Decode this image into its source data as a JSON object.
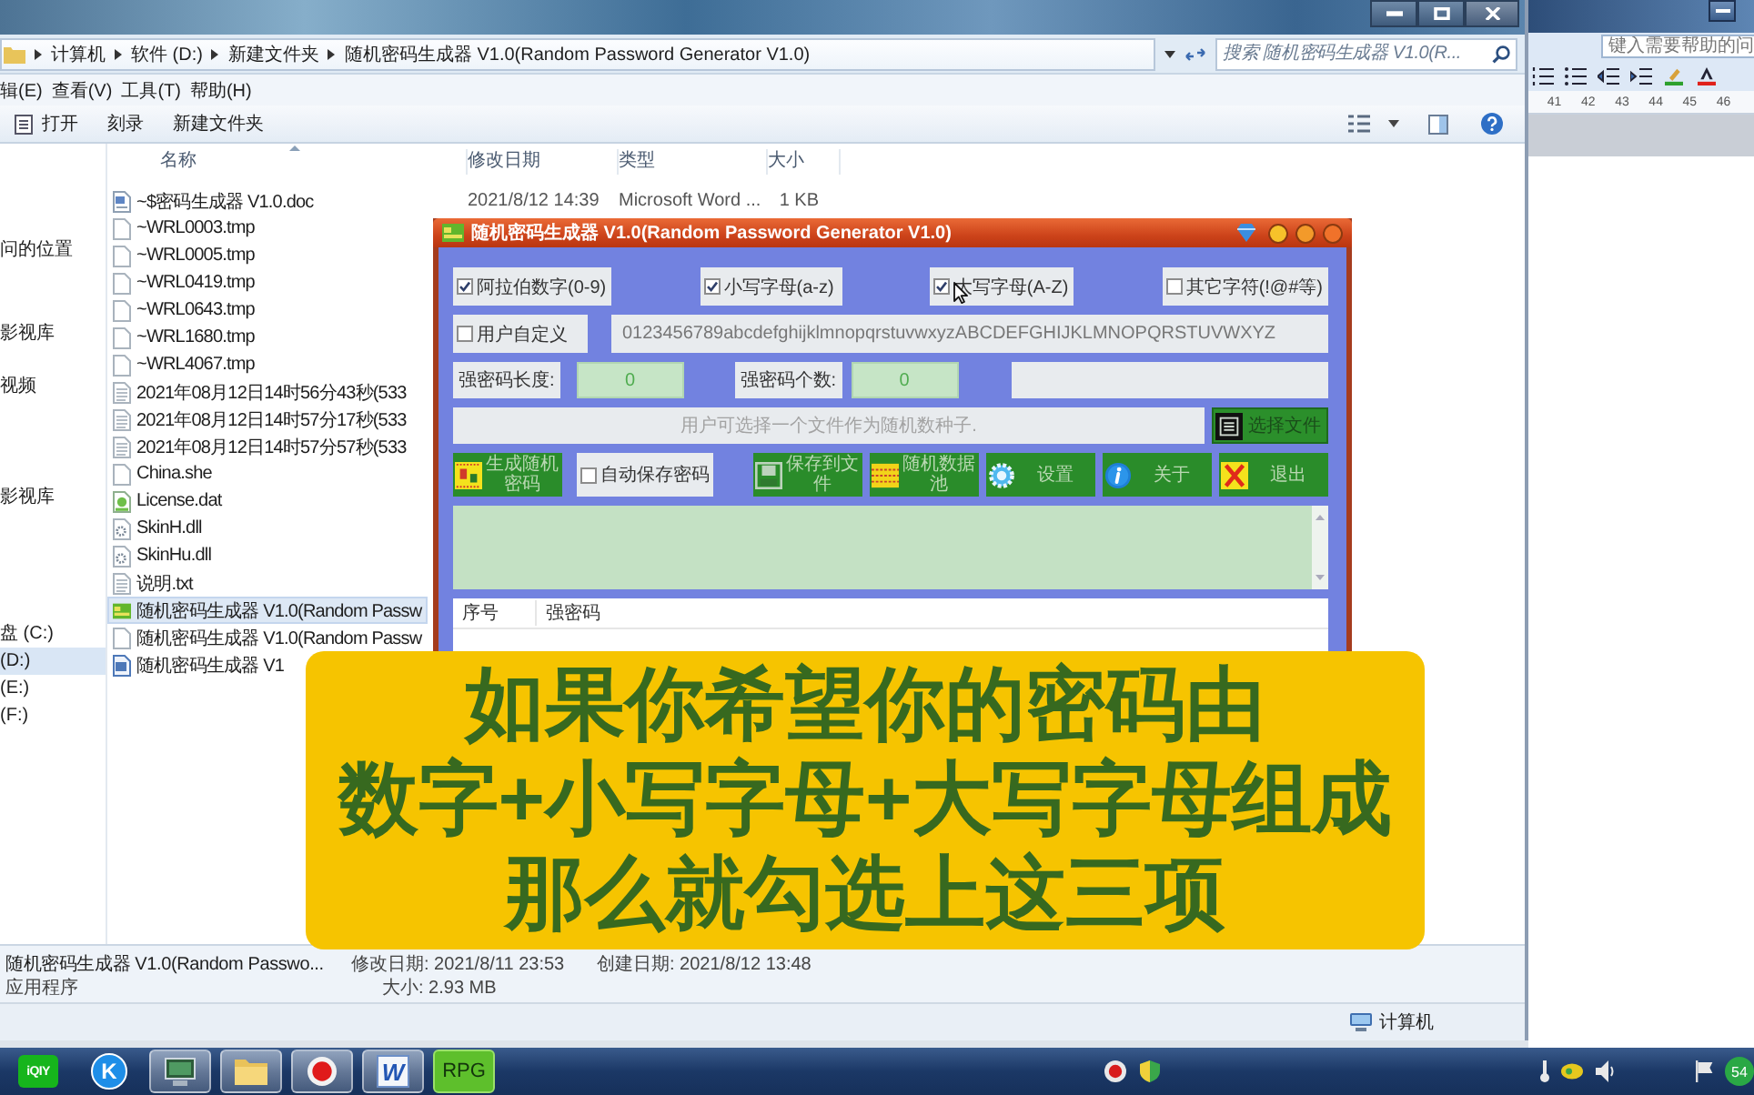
{
  "explorer": {
    "breadcrumb": [
      "计算机",
      "软件 (D:)",
      "新建文件夹",
      "随机密码生成器 V1.0(Random Password Generator V1.0)"
    ],
    "search": {
      "placeholder": "搜索 随机密码生成器 V1.0(R..."
    },
    "menu": [
      "辑(E)",
      "查看(V)",
      "工具(T)",
      "帮助(H)"
    ],
    "toolbar": [
      {
        "label": "打开",
        "kind": "open"
      },
      {
        "label": "刻录",
        "kind": "plain"
      },
      {
        "label": "新建文件夹",
        "kind": "plain"
      }
    ],
    "nav": [
      {
        "label": "问的位置",
        "selected": false
      },
      {
        "label": "影视库",
        "selected": false
      },
      {
        "label": "视频",
        "selected": false
      },
      {
        "label": "影视库",
        "selected": false
      },
      {
        "label": "盘 (C:)",
        "selected": false
      },
      {
        "label": "(D:)",
        "selected": true
      },
      {
        "label": "(E:)",
        "selected": false
      },
      {
        "label": "(F:)",
        "selected": false
      }
    ],
    "columns": [
      "名称",
      "修改日期",
      "类型",
      "大小"
    ],
    "files": [
      {
        "name": "~$密码生成器 V1.0.doc",
        "modified": "2021/8/12 14:39",
        "type": "Microsoft Word ...",
        "size": "1 KB",
        "kind": "doc",
        "selected": false
      },
      {
        "name": "~WRL0003.tmp",
        "kind": "blank",
        "selected": false
      },
      {
        "name": "~WRL0005.tmp",
        "kind": "blank",
        "selected": false
      },
      {
        "name": "~WRL0419.tmp",
        "kind": "blank",
        "selected": false
      },
      {
        "name": "~WRL0643.tmp",
        "kind": "blank",
        "selected": false
      },
      {
        "name": "~WRL1680.tmp",
        "kind": "blank",
        "selected": false
      },
      {
        "name": "~WRL4067.tmp",
        "kind": "blank",
        "selected": false
      },
      {
        "name": "2021年08月12日14时56分43秒(533",
        "kind": "text",
        "selected": false
      },
      {
        "name": "2021年08月12日14时57分17秒(533",
        "kind": "text",
        "selected": false
      },
      {
        "name": "2021年08月12日14时57分57秒(533",
        "kind": "text",
        "selected": false
      },
      {
        "name": "China.she",
        "kind": "blank",
        "selected": false
      },
      {
        "name": "License.dat",
        "kind": "license",
        "selected": false
      },
      {
        "name": "SkinH.dll",
        "kind": "dll",
        "selected": false
      },
      {
        "name": "SkinHu.dll",
        "kind": "dll",
        "selected": false
      },
      {
        "name": "说明.txt",
        "kind": "text",
        "selected": false
      },
      {
        "name": "随机密码生成器 V1.0(Random Passw",
        "kind": "app",
        "selected": true
      },
      {
        "name": "随机密码生成器 V1.0(Random Passw",
        "kind": "blank",
        "selected": false
      },
      {
        "name": "随机密码生成器 V1",
        "kind": "word",
        "selected": false
      }
    ],
    "details": {
      "name": "随机密码生成器 V1.0(Random Passwo...",
      "kind_label": "应用程序",
      "modified": "修改日期: 2021/8/11 23:53",
      "created": "创建日期: 2021/8/12 13:48",
      "size": "大小: 2.93 MB"
    },
    "status": "计算机"
  },
  "word": {
    "help": {
      "placeholder": "键入需要帮助的问"
    },
    "ruler": [
      "41",
      "42",
      "43",
      "44",
      "45",
      "46"
    ]
  },
  "rpg": {
    "title": "随机密码生成器 V1.0(Random Password Generator V1.0)",
    "charsets": [
      {
        "label": "阿拉伯数字(0-9)",
        "checked": true
      },
      {
        "label": "小写字母(a-z)",
        "checked": true
      },
      {
        "label": "大写字母(A-Z)",
        "checked": true
      },
      {
        "label": "其它字符(!@#等)",
        "checked": false
      }
    ],
    "custom": {
      "label": "用户自定义",
      "checked": false,
      "value": "0123456789abcdefghijklmnopqrstuvwxyzABCDEFGHIJKLMNOPQRSTUVWXYZ"
    },
    "length": {
      "label": "强密码长度:",
      "value": "0"
    },
    "count": {
      "label": "强密码个数:",
      "value": "0"
    },
    "seed": {
      "placeholder": "用户可选择一个文件作为随机数种子."
    },
    "seed_button": "选择文件",
    "actions": [
      {
        "label": "生成随机密码",
        "kind": "generate"
      },
      {
        "label": "自动保存密码",
        "kind": "checkbox",
        "checked": false
      },
      {
        "label": "保存到文件",
        "kind": "save"
      },
      {
        "label": "随机数据池",
        "kind": "pool"
      },
      {
        "label": "设置",
        "kind": "settings"
      },
      {
        "label": "关于",
        "kind": "about"
      },
      {
        "label": "退出",
        "kind": "exit"
      }
    ],
    "list_columns": [
      "序号",
      "强密码"
    ]
  },
  "subtitle": [
    "如果你希望你的密码由",
    "数字+小写字母+大写字母组成",
    "那么就勾选上这三项"
  ],
  "taskbar": {
    "apps": [
      {
        "kind": "iqiyi",
        "label": "iQIY",
        "running": false
      },
      {
        "kind": "k",
        "label": "K",
        "running": false
      },
      {
        "kind": "monitor",
        "running": true
      },
      {
        "kind": "folder",
        "running": true
      },
      {
        "kind": "record",
        "running": true
      },
      {
        "kind": "word",
        "label": "W",
        "running": true
      },
      {
        "kind": "rpg",
        "label": "RPG",
        "running": true
      }
    ],
    "tray_badge": "54"
  }
}
